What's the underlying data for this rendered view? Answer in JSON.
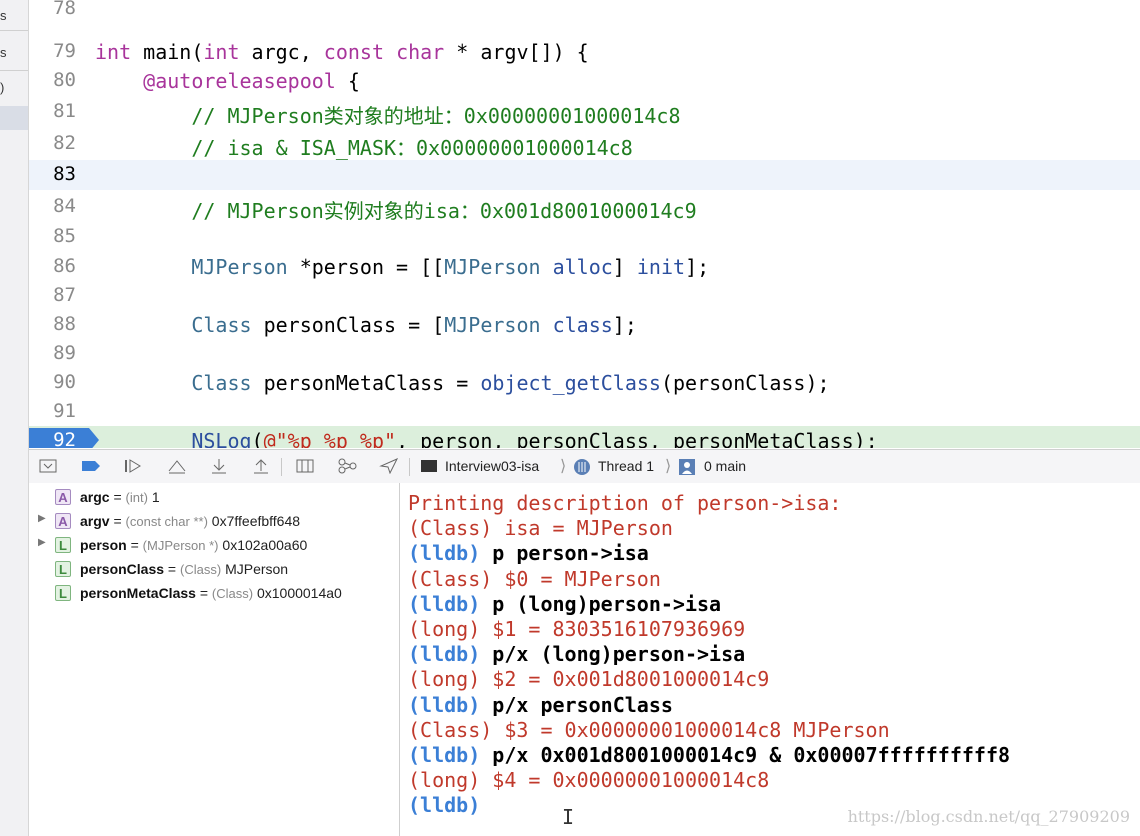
{
  "left_sidebar": {
    "fragments": [
      "s",
      "s",
      ")"
    ]
  },
  "editor": {
    "lines": [
      {
        "num": "78",
        "segs": [
          {
            "t": "",
            "c": ""
          }
        ]
      },
      {
        "num": "79",
        "segs": [
          {
            "t": "int",
            "c": "kw"
          },
          {
            "t": " main(",
            "c": ""
          },
          {
            "t": "int",
            "c": "kw"
          },
          {
            "t": " argc, ",
            "c": ""
          },
          {
            "t": "const",
            "c": "kw"
          },
          {
            "t": " ",
            "c": ""
          },
          {
            "t": "char",
            "c": "kw"
          },
          {
            "t": " * argv[]) {",
            "c": ""
          }
        ]
      },
      {
        "num": "80",
        "segs": [
          {
            "t": "    ",
            "c": ""
          },
          {
            "t": "@autoreleasepool",
            "c": "kw"
          },
          {
            "t": " {",
            "c": ""
          }
        ]
      },
      {
        "num": "81",
        "segs": [
          {
            "t": "        // MJPerson类对象的地址：0x00000001000014c8",
            "c": "cm"
          }
        ]
      },
      {
        "num": "82",
        "segs": [
          {
            "t": "        // isa & ISA_MASK：0x00000001000014c8",
            "c": "cm"
          }
        ]
      },
      {
        "num": "83",
        "segs": [
          {
            "t": "",
            "c": ""
          }
        ],
        "current": true
      },
      {
        "num": "84",
        "segs": [
          {
            "t": "        // MJPerson实例对象的isa：0x001d8001000014c9",
            "c": "cm"
          }
        ]
      },
      {
        "num": "85",
        "segs": [
          {
            "t": "",
            "c": ""
          }
        ]
      },
      {
        "num": "86",
        "segs": [
          {
            "t": "        ",
            "c": ""
          },
          {
            "t": "MJPerson",
            "c": "cls"
          },
          {
            "t": " *person = [[",
            "c": ""
          },
          {
            "t": "MJPerson",
            "c": "cls"
          },
          {
            "t": " ",
            "c": ""
          },
          {
            "t": "alloc",
            "c": "msg"
          },
          {
            "t": "] ",
            "c": ""
          },
          {
            "t": "init",
            "c": "msg"
          },
          {
            "t": "];",
            "c": ""
          }
        ]
      },
      {
        "num": "87",
        "segs": [
          {
            "t": "",
            "c": ""
          }
        ]
      },
      {
        "num": "88",
        "segs": [
          {
            "t": "        ",
            "c": ""
          },
          {
            "t": "Class",
            "c": "cls"
          },
          {
            "t": " personClass = [",
            "c": ""
          },
          {
            "t": "MJPerson",
            "c": "cls"
          },
          {
            "t": " ",
            "c": ""
          },
          {
            "t": "class",
            "c": "msg"
          },
          {
            "t": "];",
            "c": ""
          }
        ]
      },
      {
        "num": "89",
        "segs": [
          {
            "t": "",
            "c": ""
          }
        ]
      },
      {
        "num": "90",
        "segs": [
          {
            "t": "        ",
            "c": ""
          },
          {
            "t": "Class",
            "c": "cls"
          },
          {
            "t": " personMetaClass = ",
            "c": ""
          },
          {
            "t": "object_getClass",
            "c": "msg"
          },
          {
            "t": "(personClass);",
            "c": ""
          }
        ]
      },
      {
        "num": "91",
        "segs": [
          {
            "t": "",
            "c": ""
          }
        ]
      },
      {
        "num": "92",
        "segs": [
          {
            "t": "        ",
            "c": ""
          },
          {
            "t": "NSLog",
            "c": "msg"
          },
          {
            "t": "(",
            "c": ""
          },
          {
            "t": "@\"%p %p %p\"",
            "c": "str"
          },
          {
            "t": ", person, personClass, personMetaClass);",
            "c": ""
          }
        ],
        "breakpoint": true
      }
    ]
  },
  "toolbar": {
    "icons": [
      "hide-debug-area-icon",
      "breakpoint-toggle-icon",
      "continue-icon",
      "step-over-icon",
      "step-into-icon",
      "step-out-icon",
      "view-hierarchy-icon",
      "memory-graph-icon",
      "simulate-location-icon"
    ],
    "crumbs": {
      "target": "Interview03-isa",
      "thread": "Thread 1",
      "frame": "0 main"
    }
  },
  "variables": [
    {
      "badge": "A",
      "kind": "a",
      "name": "argc",
      "eq": " = ",
      "type": "(int)",
      "value": " 1",
      "expandable": false
    },
    {
      "badge": "A",
      "kind": "a",
      "name": "argv",
      "eq": " = ",
      "type": "(const char **)",
      "value": " 0x7ffeefbff648",
      "expandable": true
    },
    {
      "badge": "L",
      "kind": "l",
      "name": "person",
      "eq": " = ",
      "type": "(MJPerson *)",
      "value": " 0x102a00a60",
      "expandable": true
    },
    {
      "badge": "L",
      "kind": "l",
      "name": "personClass",
      "eq": " = ",
      "type": "(Class)",
      "value": " MJPerson",
      "expandable": false
    },
    {
      "badge": "L",
      "kind": "l",
      "name": "personMetaClass",
      "eq": " = ",
      "type": "(Class)",
      "value": " 0x1000014a0",
      "expandable": false
    }
  ],
  "console": {
    "lines": [
      {
        "kind": "out",
        "text": "Printing description of person->isa:"
      },
      {
        "kind": "out",
        "text": "(Class) isa = MJPerson"
      },
      {
        "kind": "cmd",
        "prompt": "(lldb)",
        "text": " p person->isa"
      },
      {
        "kind": "out",
        "text": "(Class) $0 = MJPerson"
      },
      {
        "kind": "cmd",
        "prompt": "(lldb)",
        "text": " p (long)person->isa"
      },
      {
        "kind": "out",
        "text": "(long) $1 = 8303516107936969"
      },
      {
        "kind": "cmd",
        "prompt": "(lldb)",
        "text": " p/x (long)person->isa"
      },
      {
        "kind": "out",
        "text": "(long) $2 = 0x001d8001000014c9"
      },
      {
        "kind": "cmd",
        "prompt": "(lldb)",
        "text": " p/x personClass"
      },
      {
        "kind": "out",
        "text": "(Class) $3 = 0x00000001000014c8 MJPerson"
      },
      {
        "kind": "cmd",
        "prompt": "(lldb)",
        "text": " p/x 0x001d8001000014c9 & 0x00007ffffffffff8"
      },
      {
        "kind": "out",
        "text": "(long) $4 = 0x00000001000014c8"
      },
      {
        "kind": "cmd",
        "prompt": "(lldb)",
        "text": ""
      }
    ],
    "watermark": "https://blog.csdn.net/qq_27909209"
  }
}
